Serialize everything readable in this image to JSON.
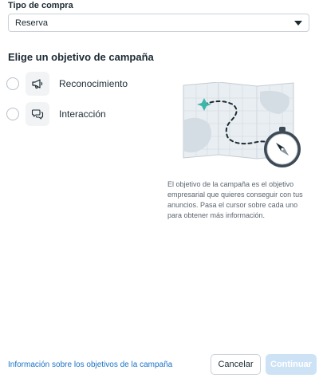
{
  "purchase_type": {
    "label": "Tipo de compra",
    "selected": "Reserva"
  },
  "objective_section": {
    "title": "Elige un objetivo de campaña",
    "options": [
      {
        "label": "Reconocimiento",
        "icon": "megaphone-icon"
      },
      {
        "label": "Interacción",
        "icon": "chat-bubbles-icon"
      }
    ]
  },
  "info_panel": {
    "illustration": "map-compass-illustration",
    "description": "El objetivo de la campaña es el objetivo empresarial que quieres conseguir con tus anuncios. Pasa el cursor sobre cada uno para obtener más información."
  },
  "footer": {
    "link_label": "Información sobre los objetivos de la campaña",
    "cancel_label": "Cancelar",
    "continue_label": "Continuar"
  },
  "colors": {
    "text": "#1c2b33",
    "link": "#1a73c7",
    "continue_disabled_bg": "#cde3f5",
    "map_accent": "#3cb6a9"
  }
}
